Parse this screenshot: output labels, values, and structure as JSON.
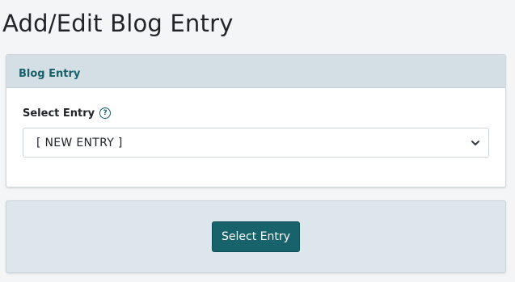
{
  "page": {
    "title": "Add/Edit Blog Entry"
  },
  "card": {
    "header_title": "Blog Entry",
    "field": {
      "label": "Select Entry",
      "help_icon": "question-circle-icon",
      "selected_value": "[ NEW ENTRY ]",
      "dropdown_icon": "chevron-down-icon"
    }
  },
  "footer": {
    "button_label": "Select Entry"
  },
  "colors": {
    "accent": "#17626b",
    "header_bg": "#d4dfe5",
    "footer_bg": "#dde6eb",
    "page_bg": "#f4f5f7"
  }
}
